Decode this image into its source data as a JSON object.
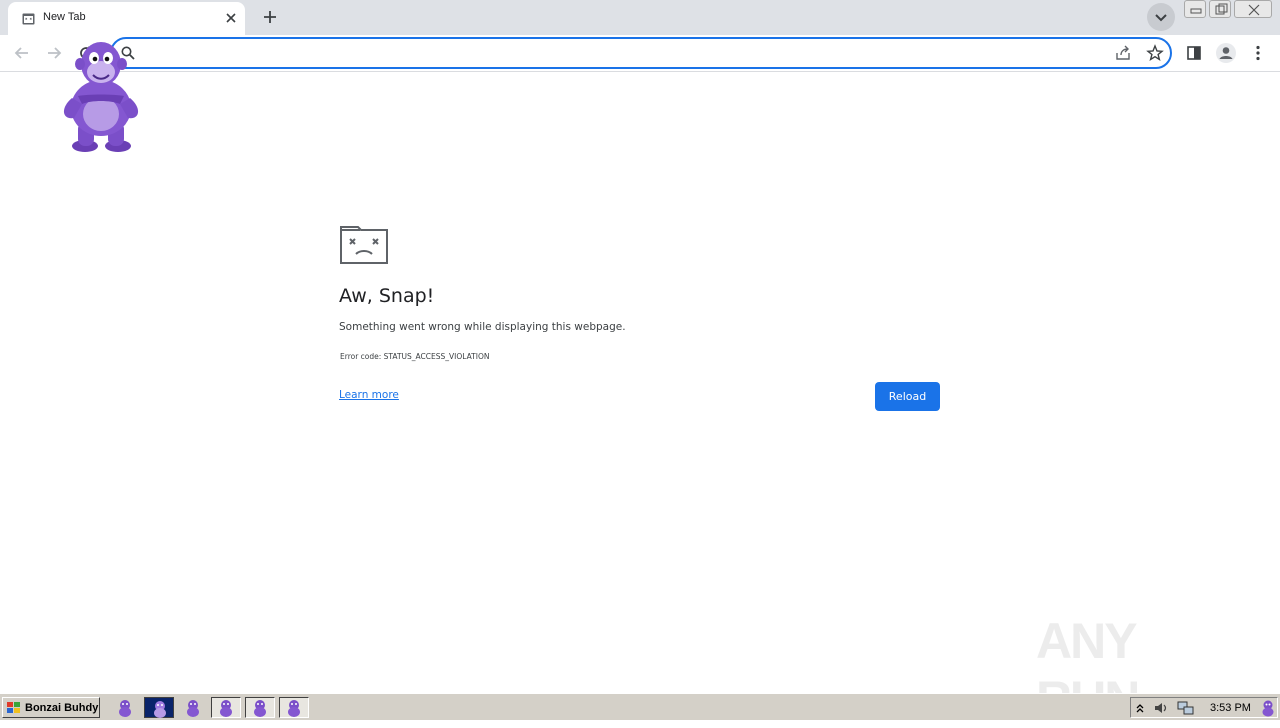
{
  "browser": {
    "tab": {
      "title": "New Tab"
    },
    "omnibox": {
      "value": "",
      "placeholder": ""
    }
  },
  "error_page": {
    "title": "Aw, Snap!",
    "message": "Something went wrong while displaying this webpage.",
    "error_code": "Error code: STATUS_ACCESS_VIOLATION",
    "learn_more": "Learn more",
    "reload": "Reload"
  },
  "watermark": {
    "text": "ANY RUN"
  },
  "taskbar": {
    "start_label": "Bonzai Buhdy",
    "clock": "3:53 PM"
  },
  "colors": {
    "accent": "#1a73e8",
    "tabstrip": "#dee1e6",
    "bonzi_purple": "#7b4fc9"
  }
}
